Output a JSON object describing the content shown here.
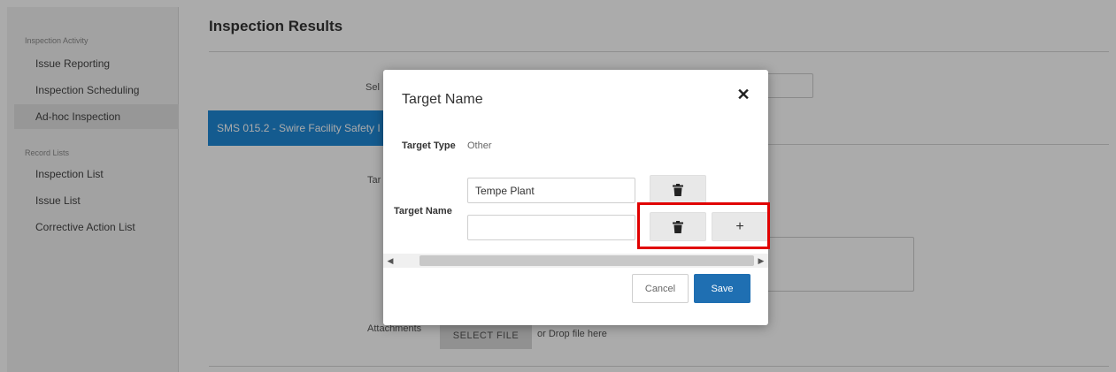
{
  "sidebar": {
    "section_activity": "Inspection Activity",
    "issue_reporting": "Issue Reporting",
    "inspection_scheduling": "Inspection Scheduling",
    "adhoc_inspection": "Ad-hoc Inspection",
    "section_records": "Record Lists",
    "inspection_list": "Inspection List",
    "issue_list": "Issue List",
    "corrective_action_list": "Corrective Action List"
  },
  "main": {
    "title": "Inspection Results",
    "select_label": "Sel",
    "banner_text": "SMS 015.2 - Swire Facility Safety I",
    "target_label": "Tar",
    "attachments_label": "Attachments",
    "select_file": "SELECT FILE",
    "drop_text": "or Drop file here"
  },
  "modal": {
    "title": "Target Name",
    "close_glyph": "✕",
    "target_type_label": "Target Type",
    "target_type_value": "Other",
    "target_name_label": "Target Name",
    "rows": [
      {
        "value": "Tempe Plant"
      },
      {
        "value": ""
      }
    ],
    "add_glyph": "+",
    "scroll_left": "◀",
    "scroll_right": "▶",
    "cancel_label": "Cancel",
    "save_label": "Save"
  },
  "colors": {
    "primary": "#1f6fb2",
    "banner": "#1e88d6",
    "highlight": "#e00000"
  }
}
